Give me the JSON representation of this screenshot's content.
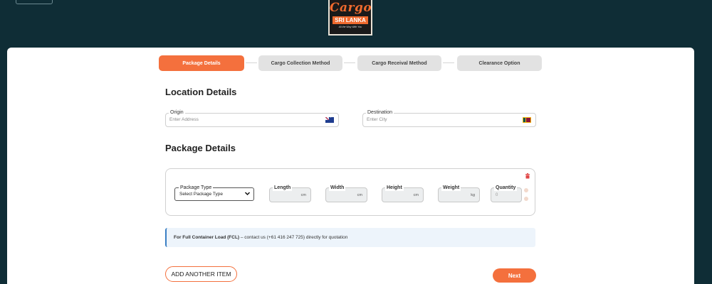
{
  "header": {
    "logo": {
      "word": "Cargo",
      "band": "SRI LANKA",
      "tagline": "All the Way With You"
    }
  },
  "steps": [
    {
      "label": "Package Details",
      "active": true
    },
    {
      "label": "Cargo Collection Method",
      "active": false
    },
    {
      "label": "Cargo Receival Method",
      "active": false
    },
    {
      "label": "Clearance Option",
      "active": false
    }
  ],
  "location": {
    "title": "Location Details",
    "origin": {
      "label": "Origin",
      "placeholder": "Enter Address",
      "flag": "australia-flag-icon"
    },
    "destination": {
      "label": "Destination",
      "placeholder": "Enter City",
      "flag": "sri-lanka-flag-icon"
    }
  },
  "package": {
    "title": "Package Details",
    "type": {
      "label": "Package Type",
      "value": "Select Package Type"
    },
    "length": {
      "label": "Length",
      "unit": "cm"
    },
    "width": {
      "label": "Width",
      "unit": "cm"
    },
    "height": {
      "label": "Height",
      "unit": "cm"
    },
    "weight": {
      "label": "Weight",
      "unit": "kg"
    },
    "quantity": {
      "label": "Quantity",
      "value": "0"
    }
  },
  "fcl": {
    "bold": "For Full Container Load (FCL)",
    "rest": " – contact us (+61 416 247 725) directly for quotation"
  },
  "buttons": {
    "add_item": "ADD ANOTHER ITEM",
    "next": "Next"
  },
  "colors": {
    "background": "#0f2d36",
    "accent": "#f4703d",
    "step_inactive": "#e2e2e2"
  }
}
